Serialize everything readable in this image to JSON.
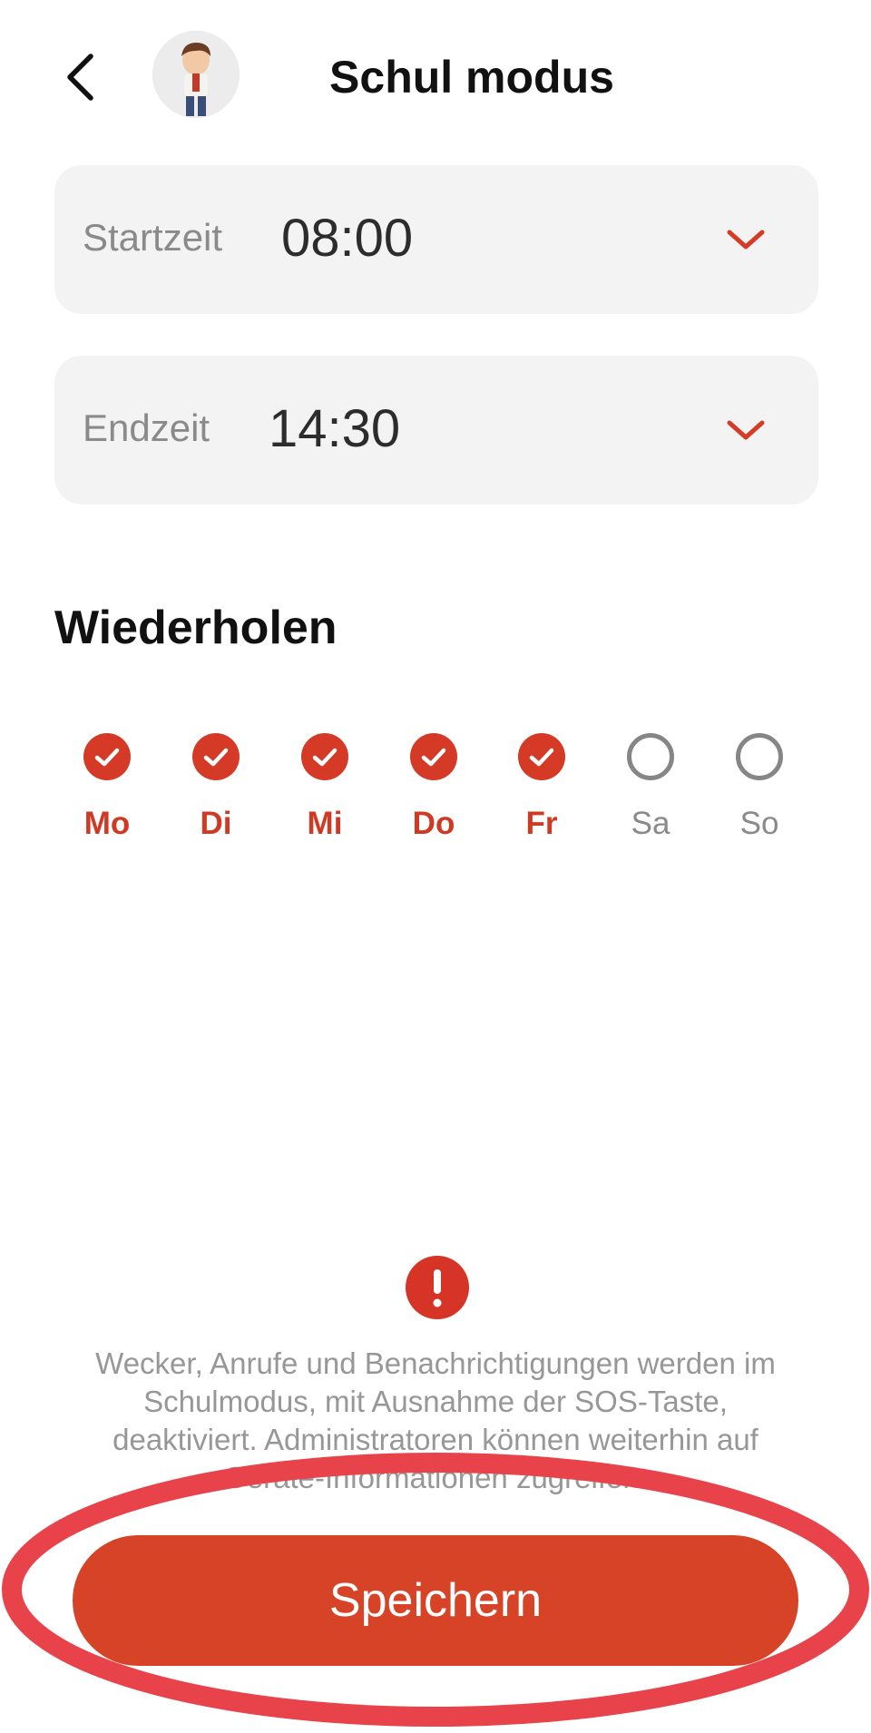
{
  "header": {
    "title": "Schul modus",
    "back_icon": "chevron-left-icon",
    "avatar": "child-avatar"
  },
  "start_time": {
    "label": "Startzeit",
    "value": "08:00",
    "icon": "chevron-down-icon"
  },
  "end_time": {
    "label": "Endzeit",
    "value": "14:30",
    "icon": "chevron-down-icon"
  },
  "repeat": {
    "title": "Wiederholen",
    "days": [
      {
        "label": "Mo",
        "selected": true
      },
      {
        "label": "Di",
        "selected": true
      },
      {
        "label": "Mi",
        "selected": true
      },
      {
        "label": "Do",
        "selected": true
      },
      {
        "label": "Fr",
        "selected": true
      },
      {
        "label": "Sa",
        "selected": false
      },
      {
        "label": "So",
        "selected": false
      }
    ]
  },
  "notice": {
    "icon": "exclamation-icon",
    "text": "Wecker, Anrufe und Benachrichtigungen werden im Schulmodus, mit Ausnahme der SOS-Taste, deaktiviert. Administratoren können weiterhin auf Geräte-Informationen zugreifen."
  },
  "save_button": {
    "label": "Speichern"
  },
  "colors": {
    "accent": "#d64327",
    "selected_day": "#d53a26",
    "unselected_day": "#868686",
    "card_bg": "#f3f3f3",
    "annotation_ring": "#e8424a"
  }
}
